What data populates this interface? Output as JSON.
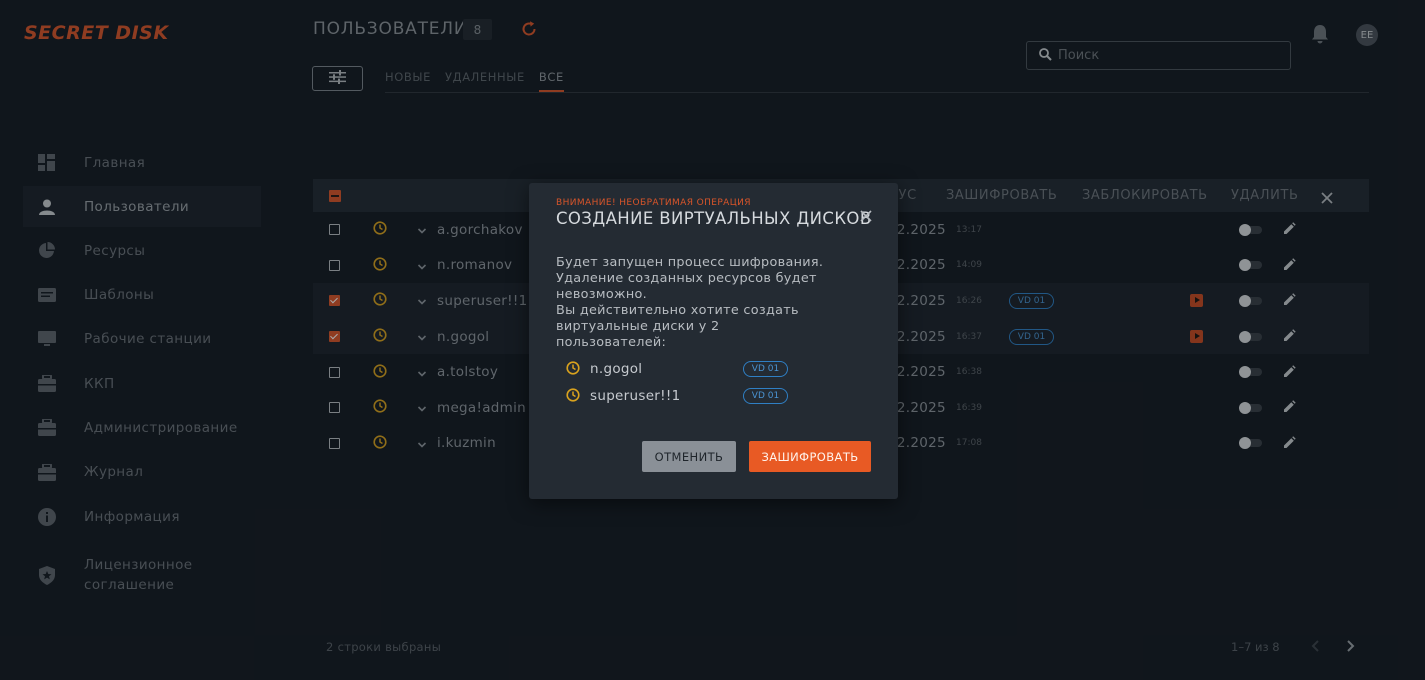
{
  "app": {
    "logo": "SECRET DISK"
  },
  "sidebar": {
    "items": [
      {
        "label": "Главная",
        "icon": "dashboard-icon"
      },
      {
        "label": "Пользователи",
        "icon": "user-icon",
        "active": true
      },
      {
        "label": "Ресурсы",
        "icon": "pie-chart-icon"
      },
      {
        "label": "Шаблоны",
        "icon": "template-icon"
      },
      {
        "label": "Рабочие станции",
        "icon": "monitor-icon"
      },
      {
        "label": "ККП",
        "icon": "briefcase-icon"
      },
      {
        "label": "Администрирование",
        "icon": "briefcase-icon"
      },
      {
        "label": "Журнал",
        "icon": "briefcase-icon"
      },
      {
        "label": "Информация",
        "icon": "info-icon"
      },
      {
        "label": "Лицензионное соглашение",
        "icon": "shield-icon"
      }
    ]
  },
  "header": {
    "title": "ПОЛЬЗОВАТЕЛИ",
    "count": "8",
    "search_placeholder": "Поиск",
    "avatar": "EE"
  },
  "tabs": [
    {
      "label": "НОВЫЕ"
    },
    {
      "label": "УДАЛЕННЫЕ"
    },
    {
      "label": "ВСЕ",
      "active": true
    }
  ],
  "table": {
    "actions": {
      "status_partial": "ТУС",
      "encrypt": "ЗАШИФРОВАТЬ",
      "block": "ЗАБЛОКИРОВАТЬ",
      "delete": "УДАЛИТЬ"
    },
    "rows": [
      {
        "name": "a.gorchakov",
        "date": "02.2025",
        "time": "13:17",
        "checked": false,
        "vd": "",
        "play": false
      },
      {
        "name": "n.romanov",
        "date": "02.2025",
        "time": "14:09",
        "checked": false,
        "vd": "",
        "play": false
      },
      {
        "name": "superuser!!1",
        "date": "02.2025",
        "time": "16:26",
        "checked": true,
        "vd": "VD 01",
        "play": true
      },
      {
        "name": "n.gogol",
        "date": "02.2025",
        "time": "16:37",
        "checked": true,
        "vd": "VD 01",
        "play": true
      },
      {
        "name": "a.tolstoy",
        "date": "02.2025",
        "time": "16:38",
        "checked": false,
        "vd": "",
        "play": false
      },
      {
        "name": "mega!admin",
        "date": "02.2025",
        "time": "16:39",
        "checked": false,
        "vd": "",
        "play": false
      },
      {
        "name": "i.kuzmin",
        "date": "02.2025",
        "time": "17:08",
        "checked": false,
        "vd": "",
        "play": false
      }
    ]
  },
  "footer": {
    "selected": "2 строки выбраны",
    "pagination": "1–7 из 8"
  },
  "modal": {
    "warning": "ВНИМАНИЕ! НЕОБРАТИМАЯ ОПЕРАЦИЯ",
    "title": "СОЗДАНИЕ ВИРТУАЛЬНЫХ ДИСКОВ",
    "body_line1": "Будет запущен процесс шифрования.",
    "body_line2": "Удаление созданных ресурсов будет невозможно.",
    "body_line3": "Вы действительно хотите создать виртуальные диски у 2 пользователей:",
    "users": [
      {
        "name": "n.gogol",
        "vd": "VD 01"
      },
      {
        "name": "superuser!!1",
        "vd": "VD 01"
      }
    ],
    "cancel_label": "ОТМЕНИТЬ",
    "confirm_label": "ЗАШИФРОВАТЬ"
  },
  "colors": {
    "accent": "#d8552a",
    "link": "#4a93d2",
    "background": "#151b22"
  }
}
